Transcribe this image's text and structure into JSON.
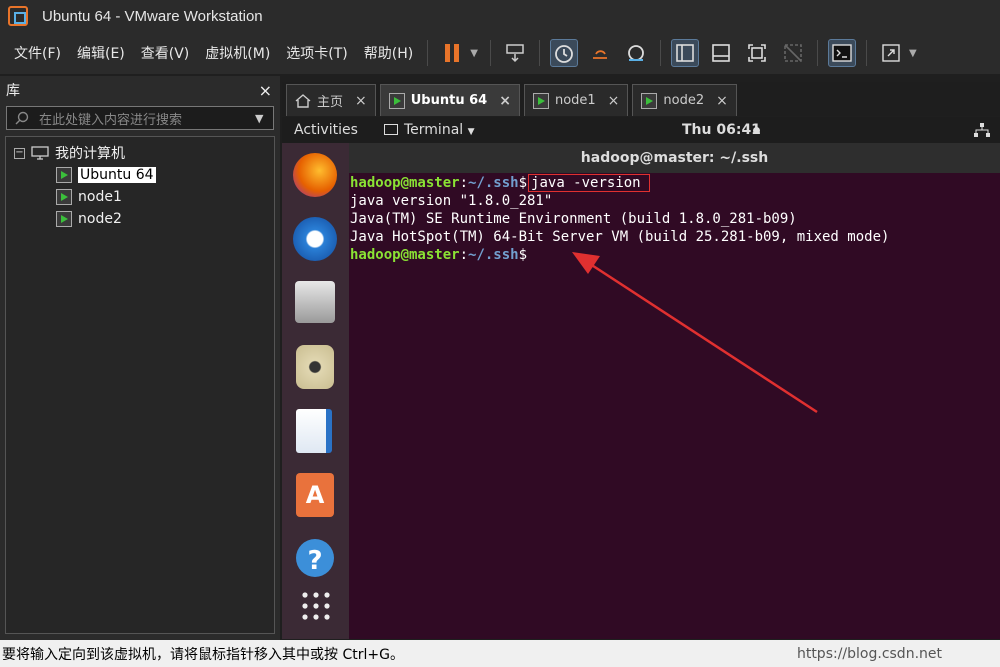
{
  "window": {
    "title": "Ubuntu 64 - VMware Workstation"
  },
  "menu": [
    "文件(F)",
    "编辑(E)",
    "查看(V)",
    "虚拟机(M)",
    "选项卡(T)",
    "帮助(H)"
  ],
  "library": {
    "title": "库",
    "close": "×",
    "search_placeholder": "在此处键入内容进行搜索",
    "root": "我的计算机",
    "vms": [
      "Ubuntu 64",
      "node1",
      "node2"
    ]
  },
  "tabs": [
    {
      "label": "主页"
    },
    {
      "label": "Ubuntu 64"
    },
    {
      "label": "node1"
    },
    {
      "label": "node2"
    }
  ],
  "tab_close": "×",
  "guest": {
    "activities": "Activities",
    "app": "Terminal",
    "clock": "Thu 06:41",
    "terminal_title": "hadoop@master: ~/.ssh"
  },
  "terminal": {
    "prompt_user": "hadoop@master",
    "prompt_sep": ":",
    "prompt_path": "~/.ssh",
    "prompt_end": "$",
    "command": "java -version",
    "output": [
      "java version \"1.8.0_281\"",
      "Java(TM) SE Runtime Environment (build 1.8.0_281-b09)",
      "Java HotSpot(TM) 64-Bit Server VM (build 25.281-b09, mixed mode)"
    ]
  },
  "status": {
    "text": "要将输入定向到该虚拟机，请将鼠标指针移入其中或按 Ctrl+G。",
    "watermark": "https://blog.csdn.net"
  },
  "colors": {
    "accent": "#e8742a",
    "prompt": "#8ae234",
    "path": "#729fcf",
    "annotation": "#e03030"
  }
}
